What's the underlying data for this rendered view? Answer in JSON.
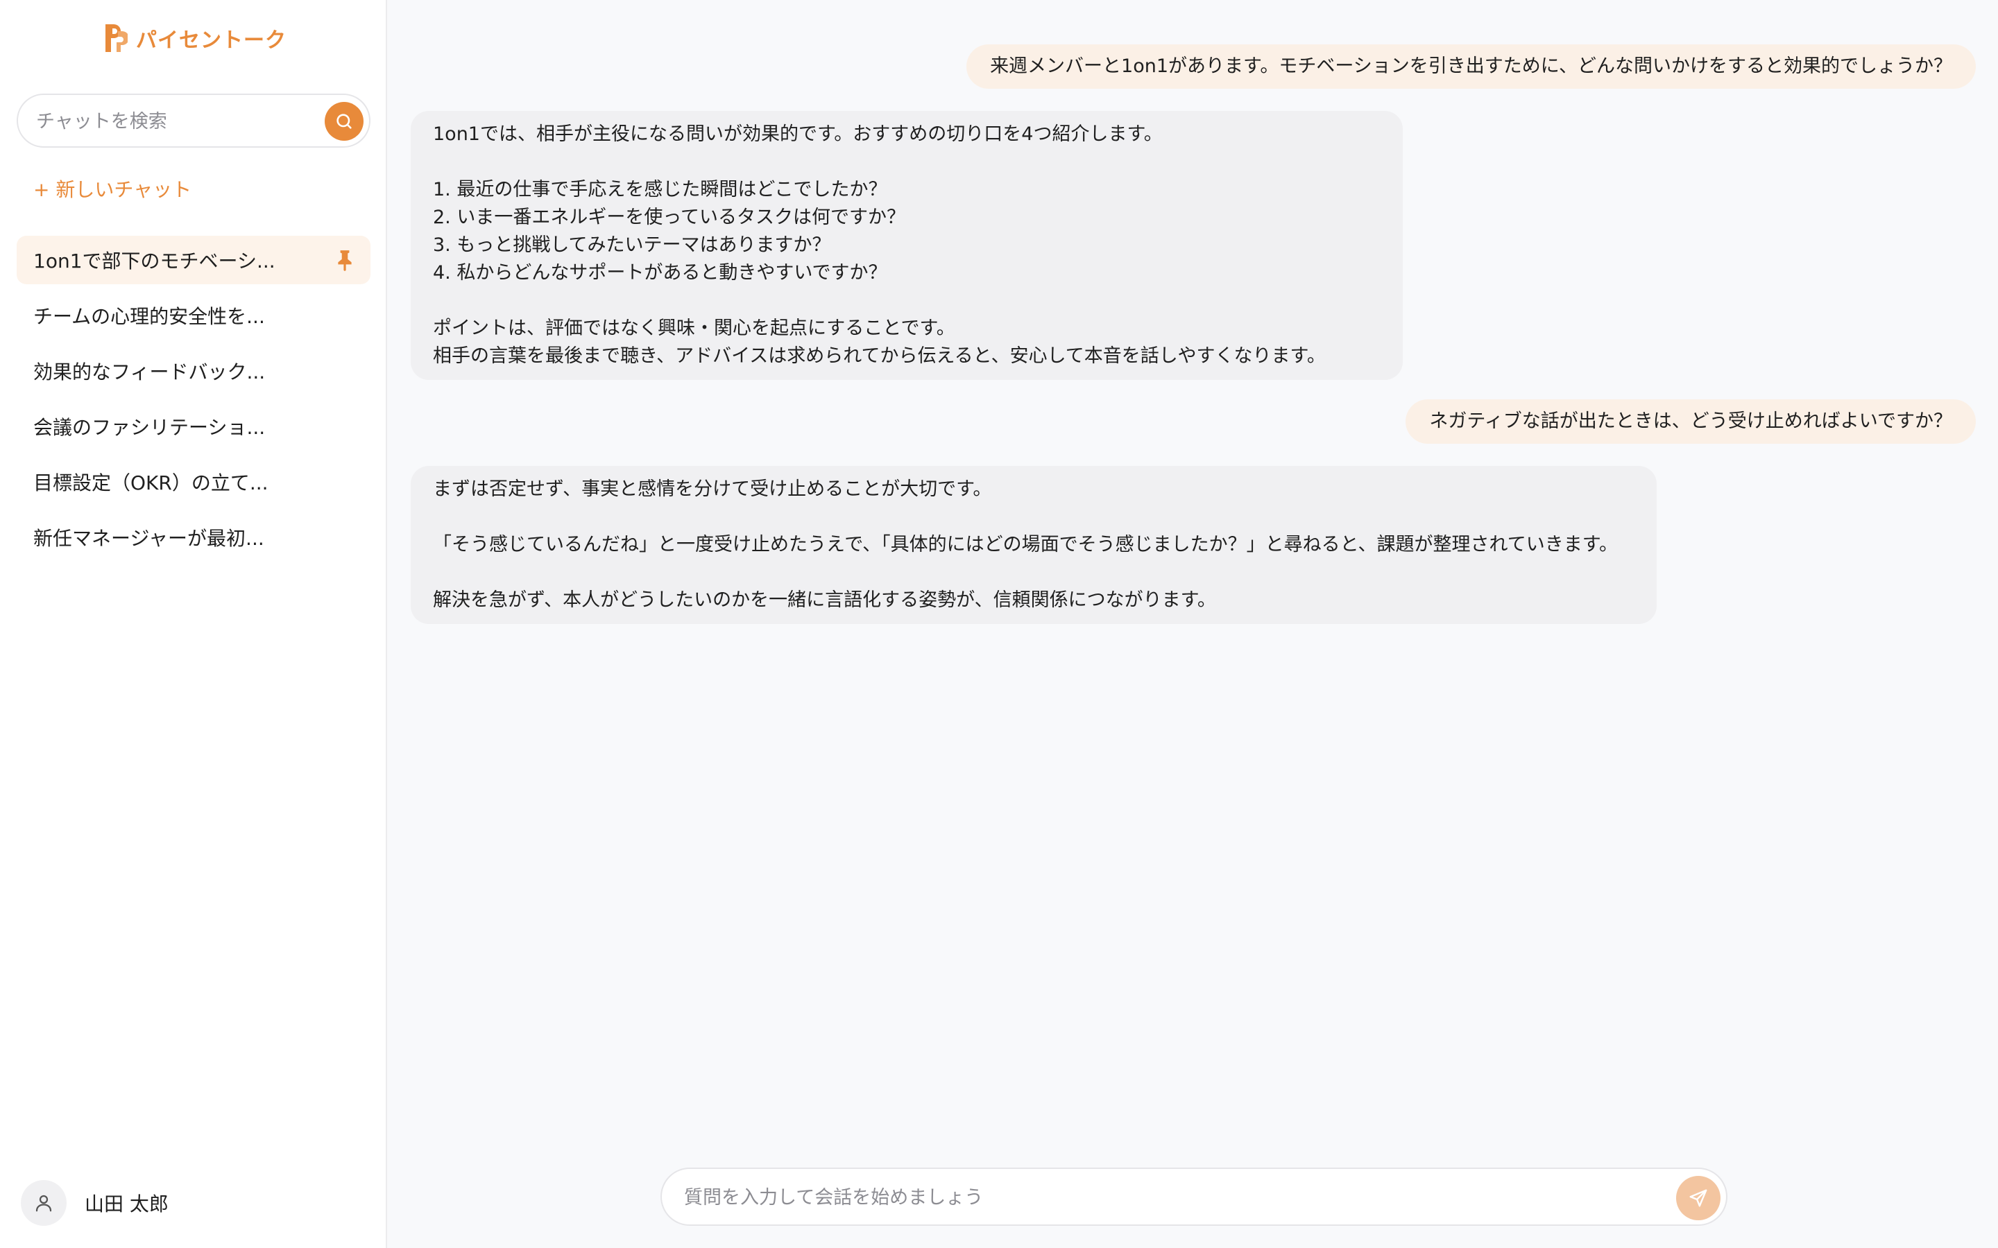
{
  "app": {
    "name": "パイセントーク",
    "accent_color": "#e88a3a"
  },
  "sidebar": {
    "search": {
      "placeholder": "チャットを検索",
      "value": ""
    },
    "new_chat_label": "+ 新しいチャット",
    "chats": [
      {
        "label": "1on1で部下のモチベーシ...",
        "pinned": true,
        "active": true
      },
      {
        "label": "チームの心理的安全性を...",
        "pinned": false,
        "active": false
      },
      {
        "label": "効果的なフィードバック...",
        "pinned": false,
        "active": false
      },
      {
        "label": "会議のファシリテーショ...",
        "pinned": false,
        "active": false
      },
      {
        "label": "目標設定（OKR）の立て...",
        "pinned": false,
        "active": false
      },
      {
        "label": "新任マネージャーが最初...",
        "pinned": false,
        "active": false
      }
    ],
    "user": {
      "name": "山田 太郎"
    }
  },
  "conversation": {
    "messages": [
      {
        "role": "user",
        "text": "来週メンバーと1on1があります。モチベーションを引き出すために、どんな問いかけをすると効果的でしょうか？"
      },
      {
        "role": "assistant",
        "text": "1on1では、相手が主役になる問いが効果的です。おすすめの切り口を4つ紹介します。\n\n1. 最近の仕事で手応えを感じた瞬間はどこでしたか？\n2. いま一番エネルギーを使っているタスクは何ですか？\n3. もっと挑戦してみたいテーマはありますか？\n4. 私からどんなサポートがあると動きやすいですか？\n\nポイントは、評価ではなく興味・関心を起点にすることです。\n相手の言葉を最後まで聴き、アドバイスは求められてから伝えると、安心して本音を話しやすくなります。"
      },
      {
        "role": "user",
        "text": "ネガティブな話が出たときは、どう受け止めればよいですか？"
      },
      {
        "role": "assistant",
        "text": "まずは否定せず、事実と感情を分けて受け止めることが大切です。\n\n「そう感じているんだね」と一度受け止めたうえで、「具体的にはどの場面でそう感じましたか？」と尋ねると、課題が整理されていきます。\n\n解決を急がず、本人がどうしたいのかを一緒に言語化する姿勢が、信頼関係につながります。"
      }
    ]
  },
  "composer": {
    "placeholder": "質問を入力して会話を始めましょう",
    "value": ""
  }
}
